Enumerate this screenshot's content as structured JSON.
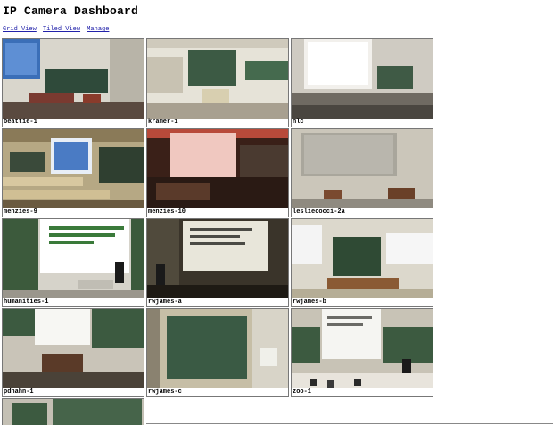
{
  "page": {
    "title": "IP Camera Dashboard"
  },
  "nav": {
    "links": [
      "Grid View",
      "Tiled View",
      "Manage"
    ]
  },
  "cameras": [
    {
      "name": "beattie-1"
    },
    {
      "name": "kramer-1"
    },
    {
      "name": "nlc"
    },
    {
      "name": "menzies-9"
    },
    {
      "name": "menzies-10"
    },
    {
      "name": "lesliecocci-2a"
    },
    {
      "name": "humanities-1"
    },
    {
      "name": "rwjames-a"
    },
    {
      "name": "rwjames-b"
    },
    {
      "name": "pdhahn-1"
    },
    {
      "name": "rwjames-c"
    },
    {
      "name": "zoo-1"
    },
    {
      "name": ""
    }
  ]
}
